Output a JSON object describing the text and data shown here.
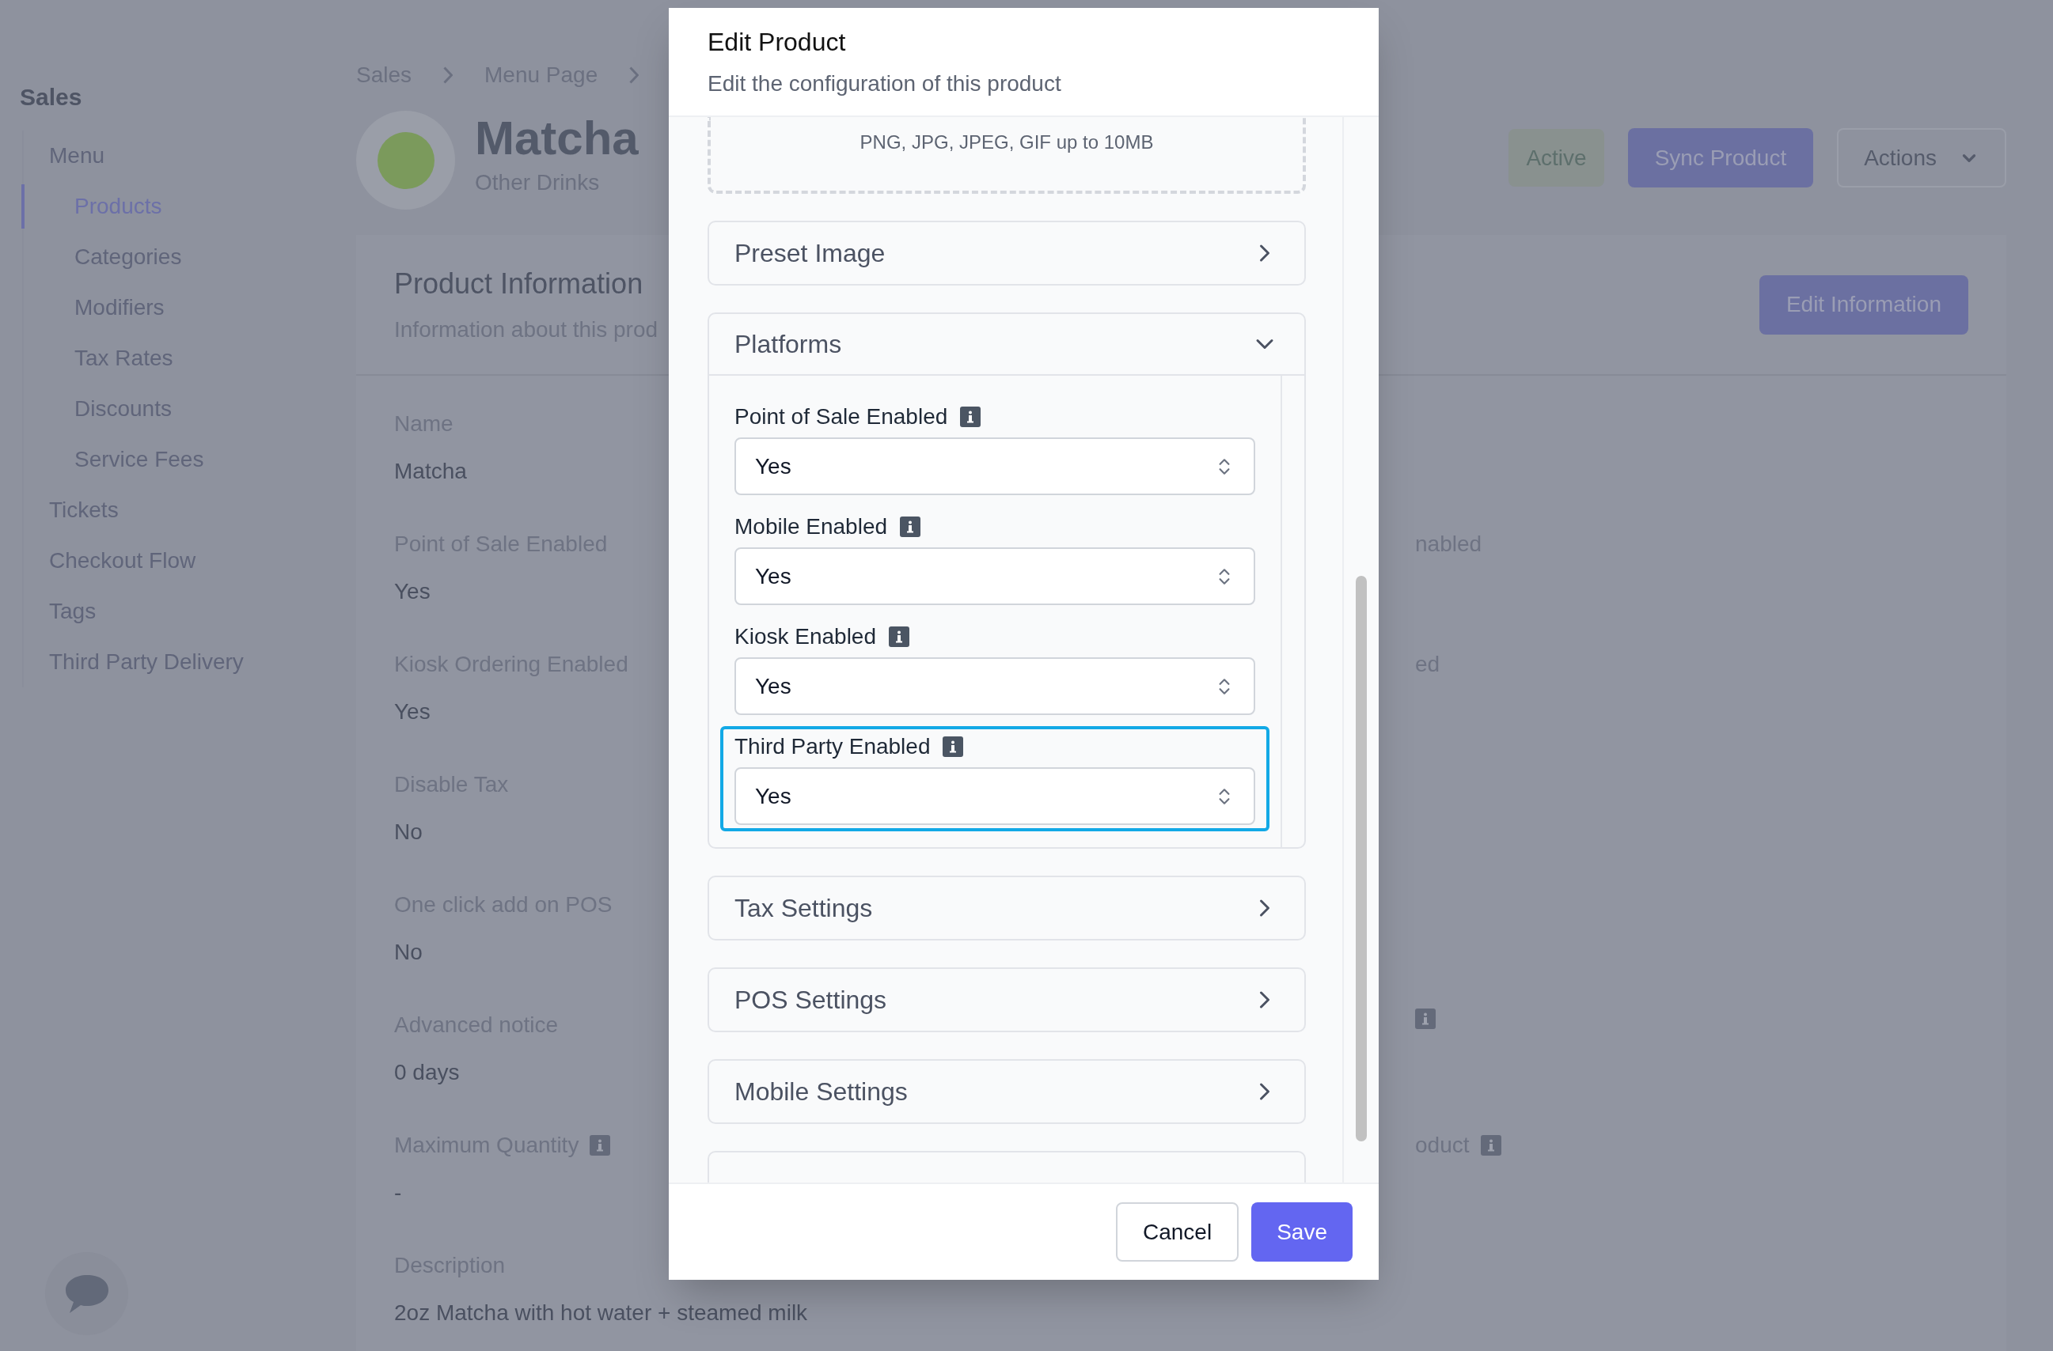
{
  "sidebar": {
    "title": "Sales",
    "items": [
      {
        "label": "Menu",
        "selected": false,
        "children": [
          {
            "label": "Products",
            "selected": true
          },
          {
            "label": "Categories",
            "selected": false
          },
          {
            "label": "Modifiers",
            "selected": false
          },
          {
            "label": "Tax Rates",
            "selected": false
          },
          {
            "label": "Discounts",
            "selected": false
          },
          {
            "label": "Service Fees",
            "selected": false
          }
        ]
      },
      {
        "label": "Tickets",
        "selected": false
      },
      {
        "label": "Checkout Flow",
        "selected": false
      },
      {
        "label": "Tags",
        "selected": false
      },
      {
        "label": "Third Party Delivery",
        "selected": false
      }
    ]
  },
  "breadcrumb": [
    "Sales",
    "Menu Page"
  ],
  "product": {
    "name": "Matcha",
    "category": "Other Drinks",
    "status": "Active"
  },
  "header_buttons": [
    {
      "label": "Sync Product",
      "kind": "primary"
    },
    {
      "label": "Actions",
      "kind": "menu"
    }
  ],
  "info_card": {
    "title": "Product Information",
    "subtitle": "Information about this prod",
    "button": "Edit Information",
    "rows": [
      {
        "left": {
          "label": "Name",
          "value": "Matcha",
          "info": false
        }
      },
      {
        "left": {
          "label": "Point of Sale Enabled",
          "value": "Yes",
          "info": false
        },
        "right": {
          "label": "nabled",
          "info": false
        }
      },
      {
        "left": {
          "label": "Kiosk Ordering Enabled",
          "value": "Yes",
          "info": false
        },
        "right": {
          "label": "ed",
          "info": false
        }
      },
      {
        "left": {
          "label": "Disable Tax",
          "value": "No",
          "info": false
        }
      },
      {
        "left": {
          "label": "One click add on POS",
          "value": "No",
          "info": false
        }
      },
      {
        "left": {
          "label": "Advanced notice",
          "value": "0 days",
          "info": false
        },
        "right": {
          "info": true
        }
      },
      {
        "left": {
          "label": "Maximum Quantity",
          "value": "-",
          "info": true
        },
        "right": {
          "label": "oduct",
          "info": true
        }
      },
      {
        "left": {
          "label": "Description",
          "value": "2oz Matcha with hot water + steamed milk",
          "info": false
        }
      }
    ]
  },
  "modal": {
    "title": "Edit Product",
    "subtitle": "Edit the configuration of this product",
    "upload_hint": "PNG, JPG, JPEG, GIF up to 10MB",
    "sections": [
      {
        "title": "Preset Image",
        "expanded": false
      },
      {
        "title": "Platforms",
        "expanded": true,
        "fields": [
          {
            "label": "Point of Sale Enabled",
            "value": "Yes",
            "highlighted": false
          },
          {
            "label": "Mobile Enabled",
            "value": "Yes",
            "highlighted": false
          },
          {
            "label": "Kiosk Enabled",
            "value": "Yes",
            "highlighted": false
          },
          {
            "label": "Third Party Enabled",
            "value": "Yes",
            "highlighted": true
          }
        ]
      },
      {
        "title": "Tax Settings",
        "expanded": false
      },
      {
        "title": "POS Settings",
        "expanded": false
      },
      {
        "title": "Mobile Settings",
        "expanded": false
      }
    ],
    "buttons": [
      {
        "label": "Cancel",
        "kind": "secondary"
      },
      {
        "label": "Save",
        "kind": "primary"
      }
    ]
  }
}
